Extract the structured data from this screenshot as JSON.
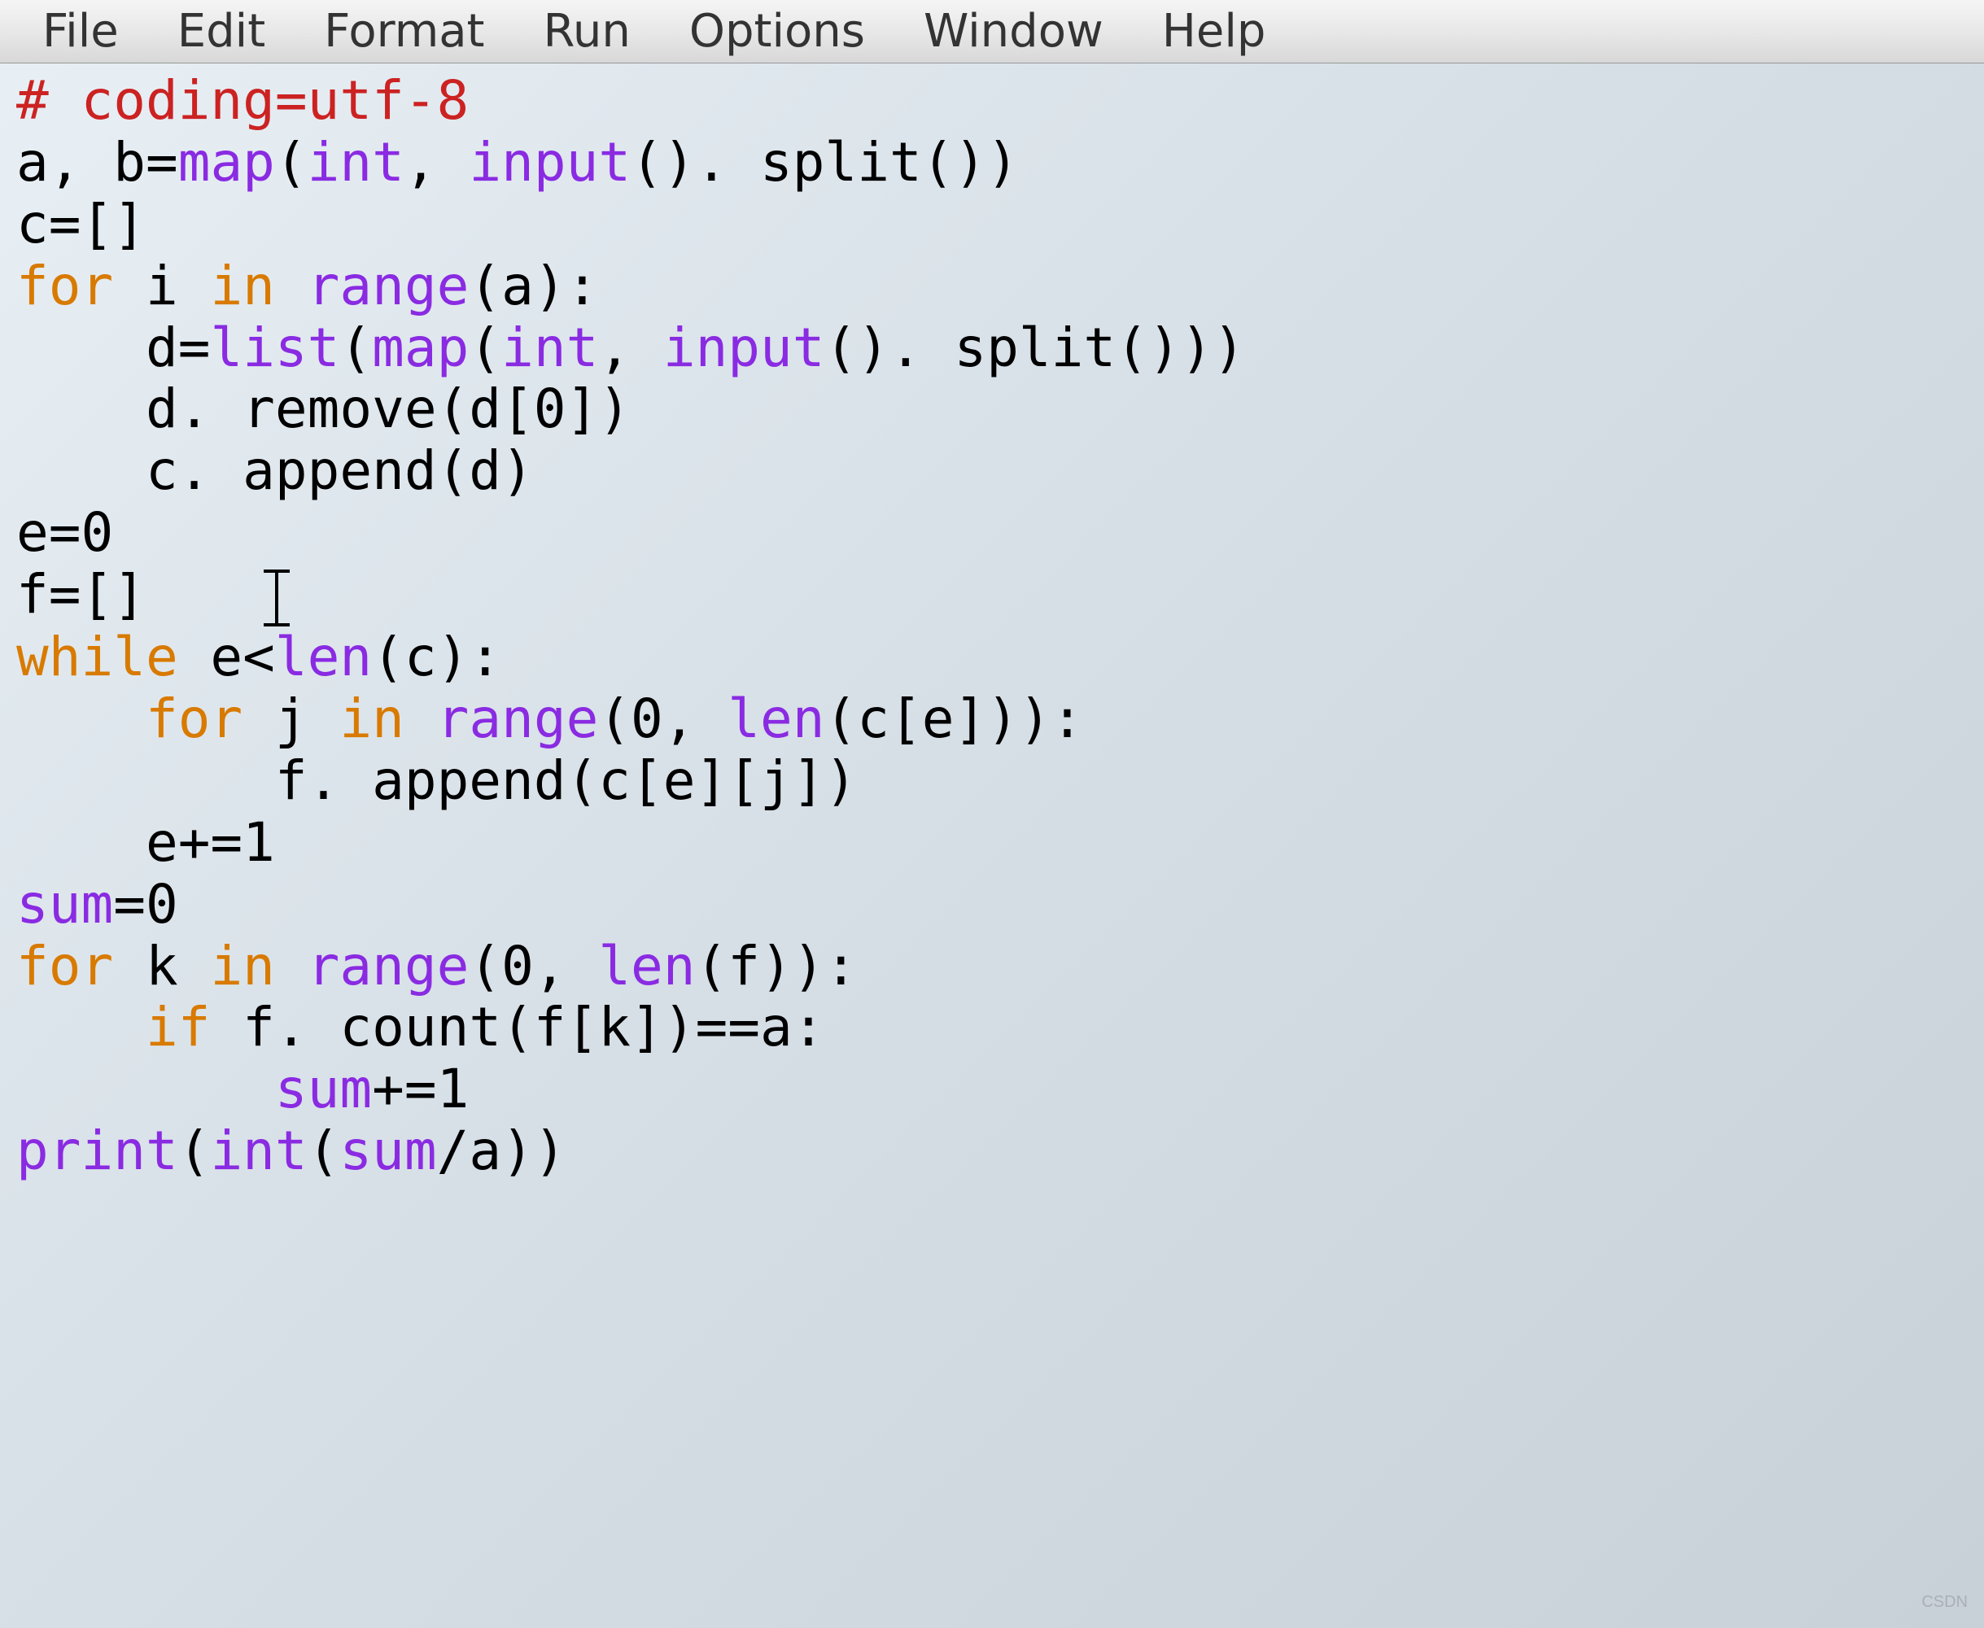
{
  "menubar": {
    "items": [
      "File",
      "Edit",
      "Format",
      "Run",
      "Options",
      "Window",
      "Help"
    ]
  },
  "code": {
    "lines": [
      {
        "indent": 0,
        "tokens": [
          {
            "t": "comment",
            "v": "# coding=utf-8"
          }
        ]
      },
      {
        "indent": 0,
        "tokens": [
          {
            "t": "def",
            "v": "a, b"
          },
          {
            "t": "op",
            "v": "="
          },
          {
            "t": "builtin",
            "v": "map"
          },
          {
            "t": "op",
            "v": "("
          },
          {
            "t": "builtin",
            "v": "int"
          },
          {
            "t": "op",
            "v": ", "
          },
          {
            "t": "builtin",
            "v": "input"
          },
          {
            "t": "op",
            "v": "(). split())"
          }
        ]
      },
      {
        "indent": 0,
        "tokens": [
          {
            "t": "def",
            "v": "c"
          },
          {
            "t": "op",
            "v": "=[]"
          }
        ]
      },
      {
        "indent": 0,
        "tokens": [
          {
            "t": "keyword",
            "v": "for"
          },
          {
            "t": "op",
            "v": " i "
          },
          {
            "t": "keyword",
            "v": "in"
          },
          {
            "t": "op",
            "v": " "
          },
          {
            "t": "builtin",
            "v": "range"
          },
          {
            "t": "op",
            "v": "(a):"
          }
        ]
      },
      {
        "indent": 1,
        "tokens": [
          {
            "t": "def",
            "v": "d"
          },
          {
            "t": "op",
            "v": "="
          },
          {
            "t": "builtin",
            "v": "list"
          },
          {
            "t": "op",
            "v": "("
          },
          {
            "t": "builtin",
            "v": "map"
          },
          {
            "t": "op",
            "v": "("
          },
          {
            "t": "builtin",
            "v": "int"
          },
          {
            "t": "op",
            "v": ", "
          },
          {
            "t": "builtin",
            "v": "input"
          },
          {
            "t": "op",
            "v": "(). split()))"
          }
        ]
      },
      {
        "indent": 1,
        "tokens": [
          {
            "t": "op",
            "v": "d. remove(d[0])"
          }
        ]
      },
      {
        "indent": 1,
        "tokens": [
          {
            "t": "op",
            "v": "c. append(d)"
          }
        ]
      },
      {
        "indent": 0,
        "tokens": [
          {
            "t": "def",
            "v": "e"
          },
          {
            "t": "op",
            "v": "=0"
          }
        ]
      },
      {
        "indent": 0,
        "tokens": [
          {
            "t": "def",
            "v": "f"
          },
          {
            "t": "op",
            "v": "=[]"
          }
        ],
        "cursorAfter": true
      },
      {
        "indent": 0,
        "tokens": [
          {
            "t": "keyword",
            "v": "while"
          },
          {
            "t": "op",
            "v": " e<"
          },
          {
            "t": "builtin",
            "v": "len"
          },
          {
            "t": "op",
            "v": "(c):"
          }
        ]
      },
      {
        "indent": 1,
        "tokens": [
          {
            "t": "keyword",
            "v": "for"
          },
          {
            "t": "op",
            "v": " j "
          },
          {
            "t": "keyword",
            "v": "in"
          },
          {
            "t": "op",
            "v": " "
          },
          {
            "t": "builtin",
            "v": "range"
          },
          {
            "t": "op",
            "v": "(0, "
          },
          {
            "t": "builtin",
            "v": "len"
          },
          {
            "t": "op",
            "v": "(c[e])):"
          }
        ]
      },
      {
        "indent": 2,
        "tokens": [
          {
            "t": "op",
            "v": "f. append(c[e][j])"
          }
        ]
      },
      {
        "indent": 1,
        "tokens": [
          {
            "t": "op",
            "v": "e+=1"
          }
        ]
      },
      {
        "indent": 0,
        "tokens": [
          {
            "t": "builtin",
            "v": "sum"
          },
          {
            "t": "op",
            "v": "=0"
          }
        ]
      },
      {
        "indent": 0,
        "tokens": [
          {
            "t": "keyword",
            "v": "for"
          },
          {
            "t": "op",
            "v": " k "
          },
          {
            "t": "keyword",
            "v": "in"
          },
          {
            "t": "op",
            "v": " "
          },
          {
            "t": "builtin",
            "v": "range"
          },
          {
            "t": "op",
            "v": "(0, "
          },
          {
            "t": "builtin",
            "v": "len"
          },
          {
            "t": "op",
            "v": "(f)):"
          }
        ]
      },
      {
        "indent": 1,
        "tokens": [
          {
            "t": "keyword",
            "v": "if"
          },
          {
            "t": "op",
            "v": " f. count(f[k])==a:"
          }
        ]
      },
      {
        "indent": 2,
        "tokens": [
          {
            "t": "builtin",
            "v": "sum"
          },
          {
            "t": "op",
            "v": "+=1"
          }
        ]
      },
      {
        "indent": 0,
        "tokens": [
          {
            "t": "builtin",
            "v": "print"
          },
          {
            "t": "op",
            "v": "("
          },
          {
            "t": "builtin",
            "v": "int"
          },
          {
            "t": "op",
            "v": "("
          },
          {
            "t": "builtin",
            "v": "sum"
          },
          {
            "t": "op",
            "v": "/a))"
          }
        ]
      }
    ]
  },
  "watermark": "CSDN"
}
